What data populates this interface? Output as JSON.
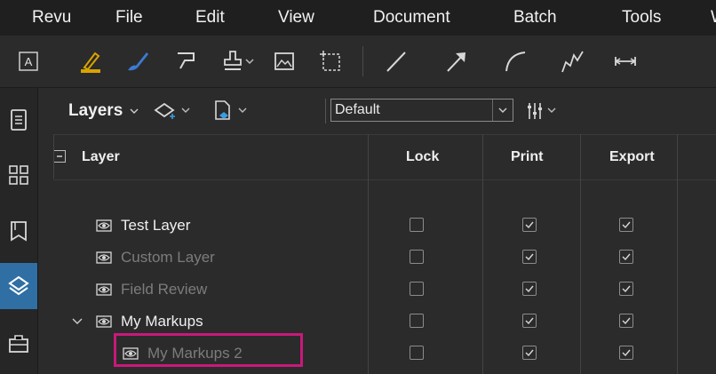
{
  "menubar": {
    "items": [
      "Revu",
      "File",
      "Edit",
      "View",
      "Document",
      "Batch",
      "Tools",
      "W"
    ]
  },
  "toolbar": {
    "icons": [
      "text-box-icon",
      "highlight-pen-icon",
      "pen-icon",
      "callout-icon",
      "stamp-icon",
      "image-icon",
      "dashed-rectangle-icon",
      "line-icon",
      "arrow-icon",
      "arc-icon",
      "polyline-icon",
      "dimension-icon"
    ]
  },
  "sidebar": {
    "icons": [
      "file-list-icon",
      "thumbnails-icon",
      "bookmarks-icon",
      "layers-icon",
      "toolchest-icon"
    ],
    "active": "layers-icon"
  },
  "layers_panel": {
    "title": "Layers",
    "preset_value": "Default",
    "columns": {
      "layer": "Layer",
      "lock": "Lock",
      "print": "Print",
      "export": "Export"
    },
    "rows": [
      {
        "name": "Test Layer",
        "visible": true,
        "lock": false,
        "print": true,
        "export": true
      },
      {
        "name": "Custom Layer",
        "visible": false,
        "lock": false,
        "print": true,
        "export": true
      },
      {
        "name": "Field Review",
        "visible": false,
        "lock": false,
        "print": true,
        "export": true
      },
      {
        "name": "My Markups",
        "visible": true,
        "lock": false,
        "print": true,
        "export": true
      },
      {
        "name": "My Markups 2",
        "visible": false,
        "lock": false,
        "print": true,
        "export": true
      }
    ],
    "highlight_color": "#c8197a",
    "accent_color": "#2f6fa3"
  }
}
